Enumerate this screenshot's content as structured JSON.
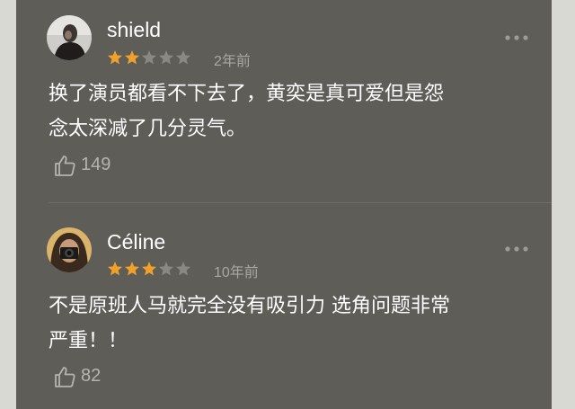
{
  "comments": [
    {
      "username": "shield",
      "rating": 2,
      "max_rating": 5,
      "time": "2年前",
      "text": "换了演员都看不下去了，黄奕是真可爱但是怨\n念太深减了几分灵气。",
      "likes": "149",
      "avatar_icon": "man-portrait-avatar"
    },
    {
      "username": "Céline",
      "rating": 3,
      "max_rating": 5,
      "time": "10年前",
      "text": "不是原班人马就完全没有吸引力 选角问题非常\n严重！！",
      "likes": "82",
      "avatar_icon": "camera-girl-avatar"
    }
  ],
  "colors": {
    "background": "#5f5d58",
    "star_filled": "#f0a12b",
    "star_empty": "#8a8883",
    "text": "#ffffff",
    "meta": "#a9a7a1"
  }
}
